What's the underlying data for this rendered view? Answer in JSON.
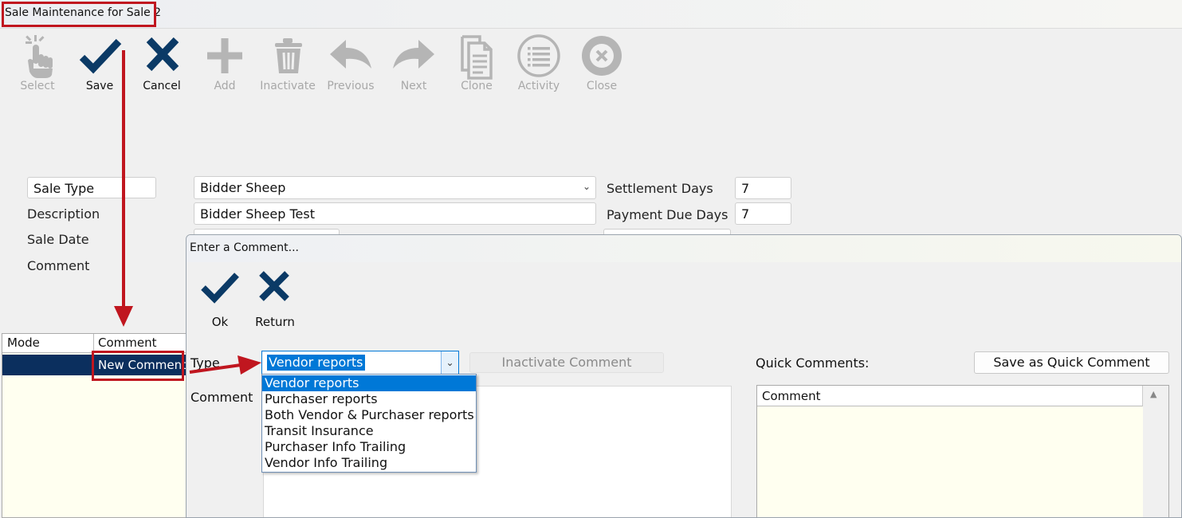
{
  "window": {
    "title": "Sale Maintenance for Sale 2"
  },
  "toolbar": {
    "select": "Select",
    "save": "Save",
    "cancel": "Cancel",
    "add": "Add",
    "inactivate": "Inactivate",
    "previous": "Previous",
    "next": "Next",
    "clone": "Clone",
    "activity": "Activity",
    "close": "Close"
  },
  "form": {
    "sale_type_label": "Sale Type",
    "sale_type_value": "Bidder Sheep",
    "description_label": "Description",
    "description_value": "Bidder Sheep Test",
    "sale_date_label": "Sale Date",
    "comment_label": "Comment",
    "settlement_days_label": "Settlement Days",
    "settlement_days_value": "7",
    "payment_due_days_label": "Payment Due Days",
    "payment_due_days_value": "7"
  },
  "grid": {
    "columns": [
      "Mode",
      "Comment"
    ],
    "rows": [
      {
        "mode": "",
        "comment": "New Comment"
      }
    ]
  },
  "dialog": {
    "title": "Enter a Comment...",
    "ok": "Ok",
    "return": "Return",
    "type_label": "Type",
    "type_value": "Vendor reports",
    "type_options": [
      "Vendor reports",
      "Purchaser reports",
      "Both Vendor & Purchaser reports",
      "Transit Insurance",
      "Purchaser Info Trailing",
      "Vendor Info Trailing"
    ],
    "inactivate_comment": "Inactivate Comment",
    "comment_label": "Comment",
    "quick_comments_label": "Quick Comments:",
    "save_quick_comment": "Save as Quick Comment",
    "quick_grid_header": "Comment"
  },
  "colors": {
    "accent_navy": "#0b3a66",
    "highlight_red": "#c0161f",
    "selection_blue": "#0078d7",
    "disabled_gray": "#a8a8a8"
  }
}
